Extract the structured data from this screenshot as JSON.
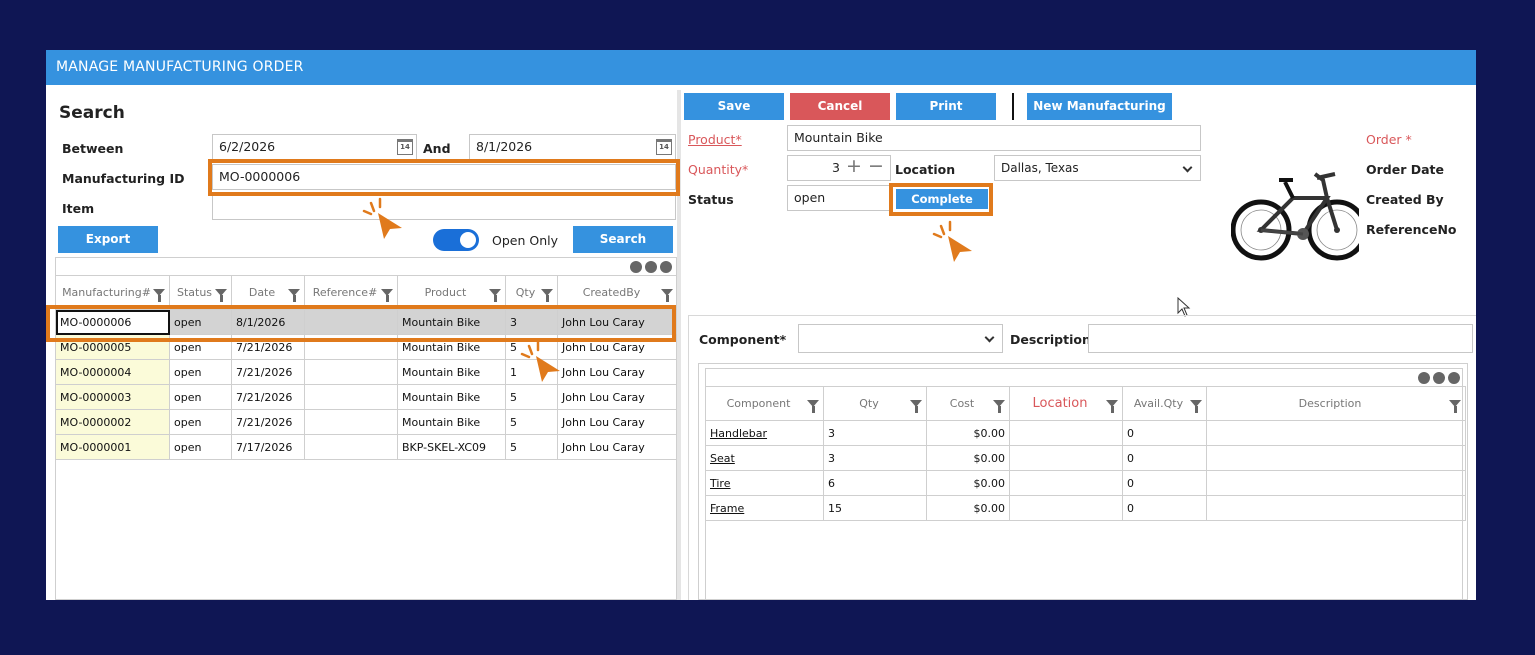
{
  "window": {
    "title": "MANAGE MANUFACTURING ORDER"
  },
  "search": {
    "heading": "Search",
    "between_label": "Between",
    "start_date": "6/2/2026",
    "and_label": "And",
    "end_date": "8/1/2026",
    "calendar_glyph": "14",
    "mfg_id_label": "Manufacturing ID",
    "mfg_id_value": "MO-0000006",
    "item_label": "Item",
    "item_value": "",
    "export_label": "Export",
    "open_only_label": "Open Only",
    "open_only_on": true,
    "search_label": "Search"
  },
  "orders_table": {
    "columns": [
      "Manufacturing#",
      "Status",
      "Date",
      "Reference#",
      "Product",
      "Qty",
      "CreatedBy"
    ],
    "rows": [
      [
        "MO-0000006",
        "open",
        "8/1/2026",
        "",
        "Mountain Bike",
        "3",
        "John Lou Caray"
      ],
      [
        "MO-0000005",
        "open",
        "7/21/2026",
        "",
        "Mountain Bike",
        "5",
        "John Lou Caray"
      ],
      [
        "MO-0000004",
        "open",
        "7/21/2026",
        "",
        "Mountain Bike",
        "1",
        "John Lou Caray"
      ],
      [
        "MO-0000003",
        "open",
        "7/21/2026",
        "",
        "Mountain Bike",
        "5",
        "John Lou Caray"
      ],
      [
        "MO-0000002",
        "open",
        "7/21/2026",
        "",
        "Mountain Bike",
        "5",
        "John Lou Caray"
      ],
      [
        "MO-0000001",
        "open",
        "7/17/2026",
        "",
        "BKP-SKEL-XC09",
        "5",
        "John Lou Caray"
      ]
    ],
    "selected_row": 0
  },
  "toolbar": {
    "save_label": "Save",
    "cancel_label": "Cancel",
    "print_label": "Print",
    "new_label": "New Manufacturing"
  },
  "form": {
    "product_label": "Product*",
    "product_value": "Mountain Bike",
    "quantity_label": "Quantity*",
    "quantity_value": "3",
    "plus_glyph": "+",
    "minus_glyph": "−",
    "location_label": "Location",
    "location_value": "Dallas, Texas",
    "status_label": "Status",
    "status_value": "open",
    "complete_label": "Complete",
    "order_label": "Order *",
    "order_date_label": "Order Date",
    "created_by_label": "Created By",
    "reference_label": "ReferenceNo"
  },
  "component": {
    "component_label": "Component*",
    "component_value": "",
    "description_label": "Description",
    "description_value": ""
  },
  "components_table": {
    "columns": [
      "Component",
      "Qty",
      "Cost",
      "Location",
      "Avail.Qty",
      "Description"
    ],
    "rows": [
      [
        "Handlebar",
        "3",
        "$0.00",
        "",
        "0",
        ""
      ],
      [
        "Seat",
        "3",
        "$0.00",
        "",
        "0",
        ""
      ],
      [
        "Tire",
        "6",
        "$0.00",
        "",
        "0",
        ""
      ],
      [
        "Frame",
        "15",
        "$0.00",
        "",
        "0",
        ""
      ]
    ]
  },
  "colors": {
    "accent": "#3592df",
    "danger": "#d9575a",
    "highlight": "#e07a1c",
    "background": "#0f1654"
  }
}
